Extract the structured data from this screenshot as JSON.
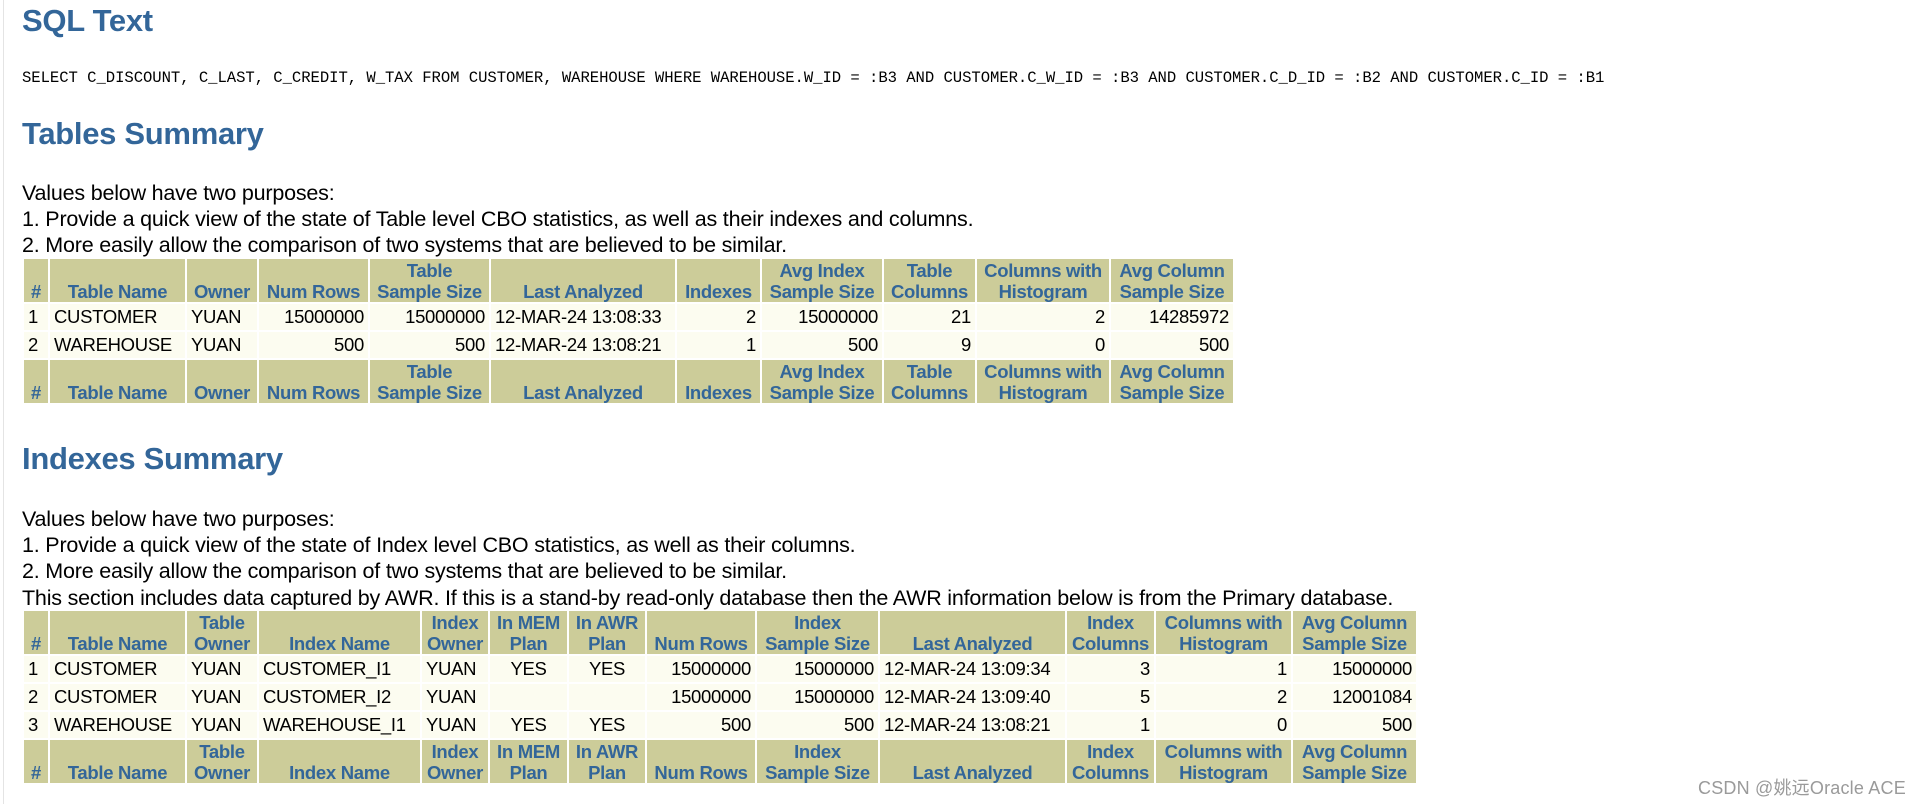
{
  "sql_text": {
    "title": "SQL Text",
    "statement": "SELECT C_DISCOUNT, C_LAST, C_CREDIT, W_TAX FROM CUSTOMER, WAREHOUSE WHERE WAREHOUSE.W_ID = :B3 AND CUSTOMER.C_W_ID = :B3 AND CUSTOMER.C_D_ID = :B2 AND CUSTOMER.C_ID = :B1"
  },
  "tables_summary": {
    "title": "Tables Summary",
    "description": [
      "Values below have two purposes:",
      "1. Provide a quick view of the state of Table level CBO statistics, as well as their indexes and columns.",
      "2. More easily allow the comparison of two systems that are believed to be similar."
    ],
    "headers": [
      [
        "",
        "#"
      ],
      [
        "",
        "Table Name"
      ],
      [
        "",
        "Owner"
      ],
      [
        "",
        "Num Rows"
      ],
      [
        "Table",
        "Sample Size"
      ],
      [
        "",
        "Last Analyzed"
      ],
      [
        "",
        "Indexes"
      ],
      [
        "Avg Index",
        "Sample Size"
      ],
      [
        "Table",
        "Columns"
      ],
      [
        "Columns with",
        "Histogram"
      ],
      [
        "Avg Column",
        "Sample Size"
      ]
    ],
    "rows": [
      [
        "1",
        "CUSTOMER",
        "YUAN",
        "15000000",
        "15000000",
        "12-MAR-24 13:08:33",
        "2",
        "15000000",
        "21",
        "2",
        "14285972"
      ],
      [
        "2",
        "WAREHOUSE",
        "YUAN",
        "500",
        "500",
        "12-MAR-24 13:08:21",
        "1",
        "500",
        "9",
        "0",
        "500"
      ]
    ]
  },
  "indexes_summary": {
    "title": "Indexes Summary",
    "description": [
      "Values below have two purposes:",
      "1. Provide a quick view of the state of Index level CBO statistics, as well as their columns.",
      "2. More easily allow the comparison of two systems that are believed to be similar.",
      "This section includes data captured by AWR. If this is a stand-by read-only database then the AWR information below is from the Primary database."
    ],
    "headers": [
      [
        "",
        "#"
      ],
      [
        "",
        "Table Name"
      ],
      [
        "Table",
        "Owner"
      ],
      [
        "",
        "Index Name"
      ],
      [
        "Index",
        "Owner"
      ],
      [
        "In MEM",
        "Plan"
      ],
      [
        "In AWR",
        "Plan"
      ],
      [
        "",
        "Num Rows"
      ],
      [
        "Index",
        "Sample Size"
      ],
      [
        "",
        "Last Analyzed"
      ],
      [
        "Index",
        "Columns"
      ],
      [
        "Columns with",
        "Histogram"
      ],
      [
        "Avg Column",
        "Sample Size"
      ]
    ],
    "rows": [
      [
        "1",
        "CUSTOMER",
        "YUAN",
        "CUSTOMER_I1",
        "YUAN",
        "YES",
        "YES",
        "15000000",
        "15000000",
        "12-MAR-24 13:09:34",
        "3",
        "1",
        "15000000"
      ],
      [
        "2",
        "CUSTOMER",
        "YUAN",
        "CUSTOMER_I2",
        "YUAN",
        "",
        "",
        "15000000",
        "15000000",
        "12-MAR-24 13:09:40",
        "5",
        "2",
        "12001084"
      ],
      [
        "3",
        "WAREHOUSE",
        "YUAN",
        "WAREHOUSE_I1",
        "YUAN",
        "YES",
        "YES",
        "500",
        "500",
        "12-MAR-24 13:08:21",
        "1",
        "0",
        "500"
      ]
    ]
  },
  "watermark": "CSDN @姚远Oracle ACE",
  "colors": {
    "title": "#336699",
    "header_bg": "#cccc99",
    "header_text": "#336699",
    "row_bg": "#fcfcf0"
  }
}
